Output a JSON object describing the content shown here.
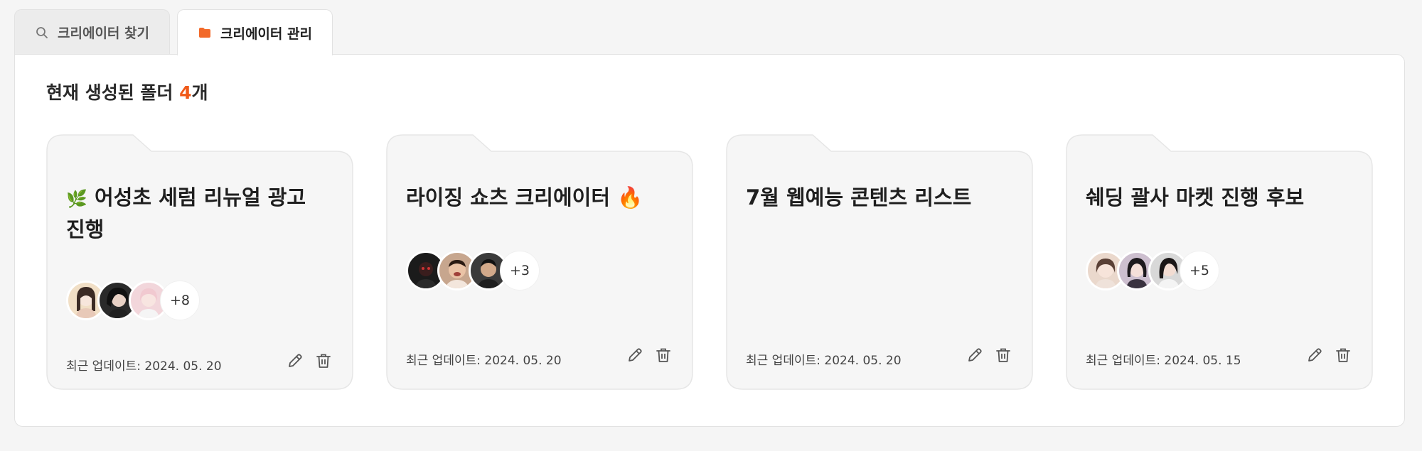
{
  "tabs": [
    {
      "label": "크리에이터 찾기",
      "icon": "search-icon",
      "active": false
    },
    {
      "label": "크리에이터 관리",
      "icon": "folder-icon",
      "active": true
    }
  ],
  "summary": {
    "prefix": "현재 생성된 폴더 ",
    "count": "4",
    "suffix": "개"
  },
  "colors": {
    "accent": "#f05a1a",
    "folder": "#f6f6f6",
    "folder_border": "#e6e6e6"
  },
  "folders": [
    {
      "emoji": "🌿",
      "title": "어성초 세럼 리뉴얼 광고 진행",
      "more": "+8",
      "updated": "최근 업데이트: 2024. 05. 20",
      "avatar_colors": [
        "#f1dfc6",
        "#2a2a2a",
        "#f2d6db"
      ]
    },
    {
      "emoji": "",
      "title": "라이징 쇼츠 크리에이터 🔥",
      "more": "+3",
      "updated": "최근 업데이트: 2024. 05. 20",
      "avatar_colors": [
        "#1b1b1b",
        "#c7a68e",
        "#3a3a3a"
      ]
    },
    {
      "emoji": "",
      "title": "7월 웹예능 콘텐츠 리스트",
      "more": "",
      "updated": "최근 업데이트: 2024. 05. 20",
      "avatar_colors": []
    },
    {
      "emoji": "",
      "title": "쉐딩 괄사 마켓 진행 후보",
      "more": "+5",
      "updated": "최근 업데이트: 2024. 05. 15",
      "avatar_colors": [
        "#ead8cc",
        "#cdbfcf",
        "#d8d8d8"
      ]
    }
  ]
}
